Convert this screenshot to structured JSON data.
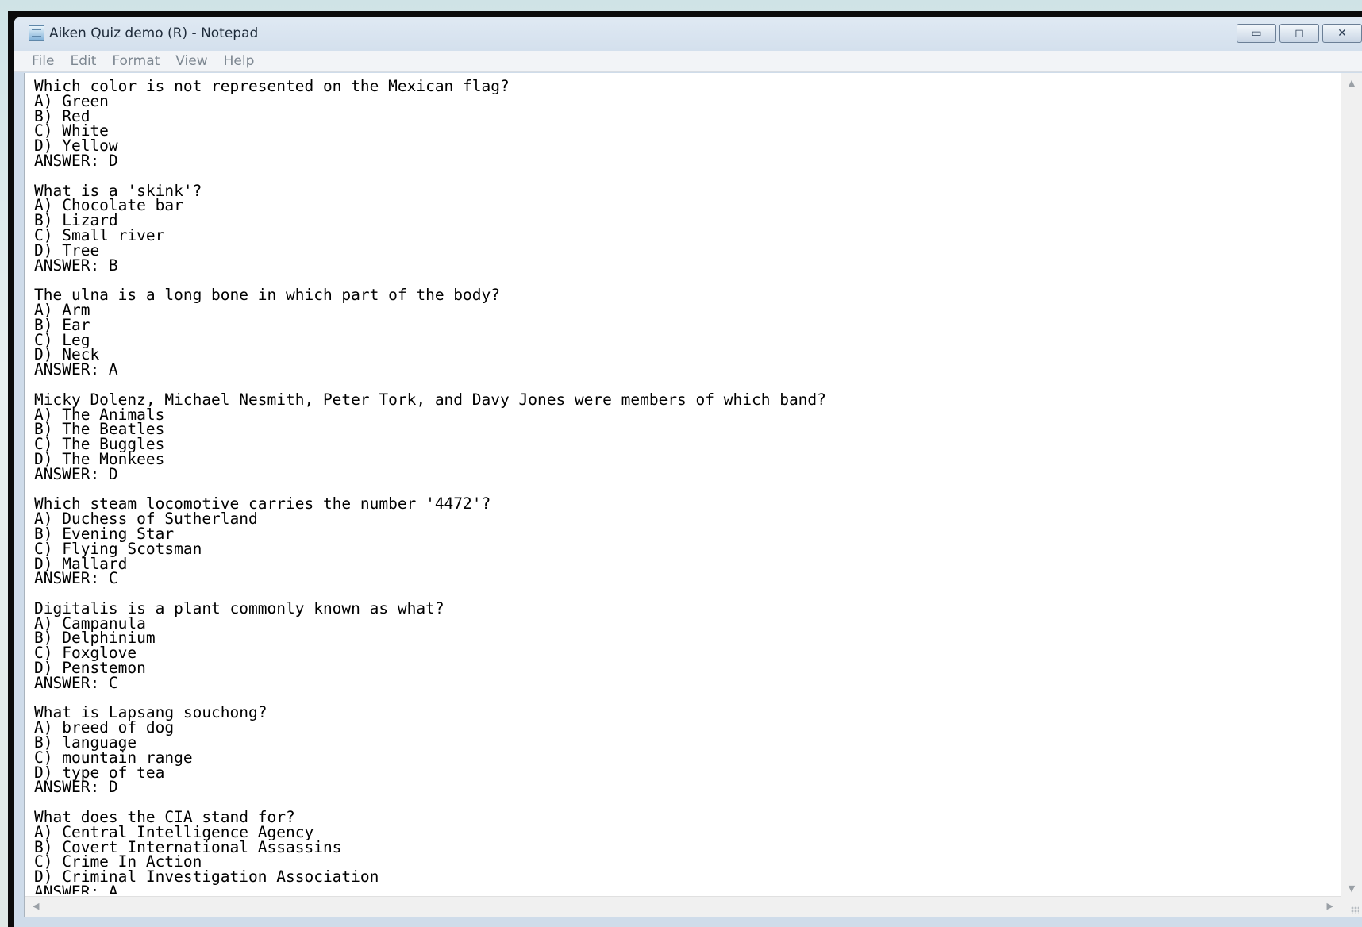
{
  "window": {
    "title": "Aiken Quiz demo (R) - Notepad",
    "controls": {
      "minimize": "▭",
      "maximize": "◻",
      "close": "✕"
    }
  },
  "menu": [
    "File",
    "Edit",
    "Format",
    "View",
    "Help"
  ],
  "document": {
    "lines": [
      "Which color is not represented on the Mexican flag?",
      "A) Green",
      "B) Red",
      "C) White",
      "D) Yellow",
      "ANSWER: D",
      "",
      "What is a 'skink'?",
      "A) Chocolate bar",
      "B) Lizard",
      "C) Small river",
      "D) Tree",
      "ANSWER: B",
      "",
      "The ulna is a long bone in which part of the body?",
      "A) Arm",
      "B) Ear",
      "C) Leg",
      "D) Neck",
      "ANSWER: A",
      "",
      "Micky Dolenz, Michael Nesmith, Peter Tork, and Davy Jones were members of which band?",
      "A) The Animals",
      "B) The Beatles",
      "C) The Buggles",
      "D) The Monkees",
      "ANSWER: D",
      "",
      "Which steam locomotive carries the number '4472'?",
      "A) Duchess of Sutherland",
      "B) Evening Star",
      "C) Flying Scotsman",
      "D) Mallard",
      "ANSWER: C",
      "",
      "Digitalis is a plant commonly known as what?",
      "A) Campanula",
      "B) Delphinium",
      "C) Foxglove",
      "D) Penstemon",
      "ANSWER: C",
      "",
      "What is Lapsang souchong?",
      "A) breed of dog",
      "B) language",
      "C) mountain range",
      "D) type of tea",
      "ANSWER: D",
      "",
      "What does the CIA stand for?",
      "A) Central Intelligence Agency",
      "B) Covert International Assassins",
      "C) Crime In Action",
      "D) Criminal Investigation Association",
      "ANSWER: A"
    ]
  }
}
